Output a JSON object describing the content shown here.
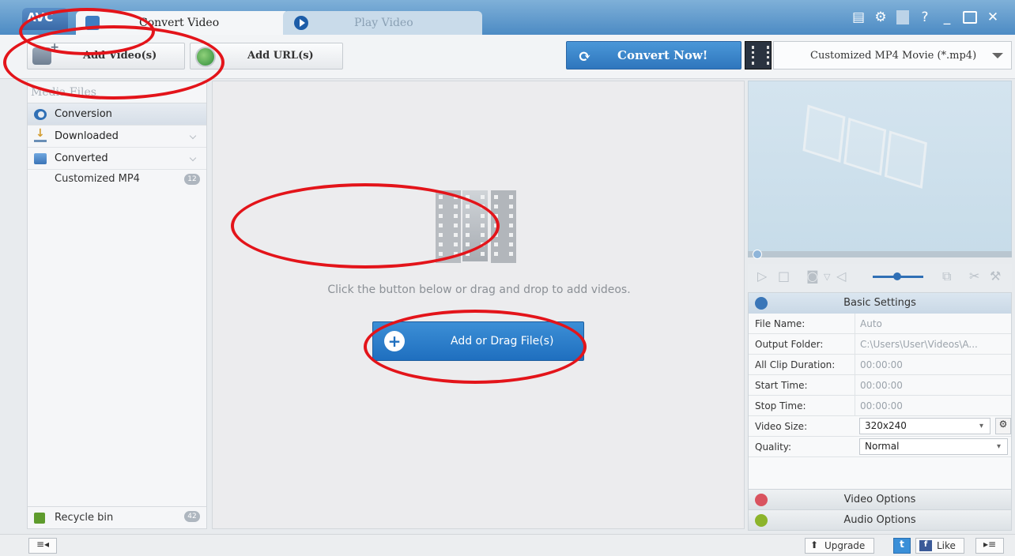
{
  "app": {
    "logo": "AVC",
    "tabs": [
      {
        "label": "Convert Video"
      },
      {
        "label": "Play Video"
      }
    ],
    "window_controls": [
      "?",
      "_",
      "✕"
    ]
  },
  "toolbar": {
    "add_video_label": "Add Video(s)",
    "add_url_label": "Add URL(s)",
    "convert_label": "Convert Now!",
    "profile_value": "Customized MP4 Movie (*.mp4)"
  },
  "sidebar": {
    "header": "Media Files",
    "items": [
      {
        "label": "Conversion"
      },
      {
        "label": "Downloaded"
      },
      {
        "label": "Converted"
      }
    ],
    "sub_item": {
      "label": "Customized MP4",
      "count": "12"
    },
    "recycle": {
      "label": "Recycle bin",
      "count": "42"
    }
  },
  "main": {
    "hint": "Click the button below or drag and drop to add videos.",
    "add_button_label": "Add or Drag File(s)"
  },
  "settings": {
    "title": "Basic Settings",
    "rows": [
      {
        "key": "File Name:",
        "value": "Auto"
      },
      {
        "key": "Output Folder:",
        "value": "C:\\Users\\User\\Videos\\A..."
      },
      {
        "key": "All Clip Duration:",
        "value": "00:00:00"
      },
      {
        "key": "Start Time:",
        "value": "00:00:00"
      },
      {
        "key": "Stop Time:",
        "value": "00:00:00"
      },
      {
        "key": "Video Size:",
        "value": "320x240"
      },
      {
        "key": "Quality:",
        "value": "Normal"
      }
    ],
    "video_options": "Video Options",
    "audio_options": "Audio Options"
  },
  "statusbar": {
    "upgrade_label": "Upgrade",
    "like_label": "Like"
  },
  "colors": {
    "accent": "#2f76bd",
    "annotation": "#e3141a"
  }
}
